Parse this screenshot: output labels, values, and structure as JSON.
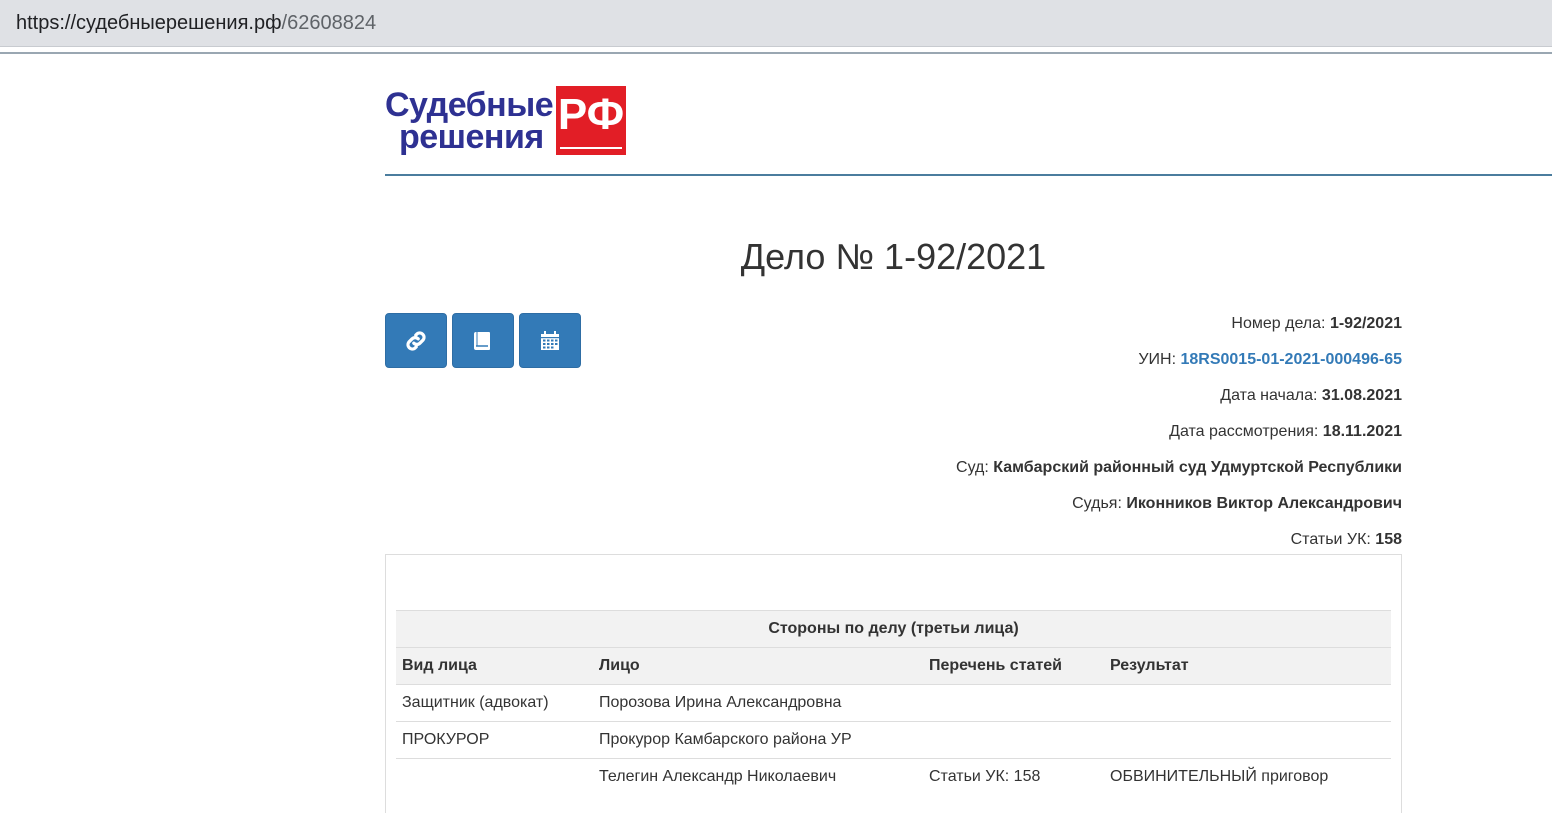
{
  "browser": {
    "url_host": "https://судебныерешения.рф",
    "url_path": "/62608824"
  },
  "logo": {
    "line1": "Судебные",
    "line2": "решения",
    "badge": "РФ",
    "colors": {
      "text": "#2e3192",
      "badge": "#e21e26"
    }
  },
  "page": {
    "title": "Дело № 1-92/2021"
  },
  "toolbar": {
    "buttons": [
      {
        "icon": "link-icon"
      },
      {
        "icon": "book-icon"
      },
      {
        "icon": "calendar-icon"
      }
    ],
    "color": "#337ab7"
  },
  "case_info": {
    "number": {
      "label": "Номер дела:",
      "value": "1-92/2021"
    },
    "uin": {
      "label": "УИН:",
      "value": "18RS0015-01-2021-000496-65"
    },
    "start_date": {
      "label": "Дата начала:",
      "value": "31.08.2021"
    },
    "review_date": {
      "label": "Дата рассмотрения:",
      "value": "18.11.2021"
    },
    "court": {
      "label": "Суд:",
      "value": "Камбарский районный суд Удмуртской Республики"
    },
    "judge": {
      "label": "Судья:",
      "value": "Иконников Виктор Александрович"
    },
    "articles": {
      "label": "Статьи УК:",
      "value": "158"
    }
  },
  "parties": {
    "caption": "Стороны по делу (третьи лица)",
    "columns": [
      "Вид лица",
      "Лицо",
      "Перечень статей",
      "Результат"
    ],
    "rows": [
      [
        "Защитник (адвокат)",
        "Порозова Ирина Александровна",
        "",
        ""
      ],
      [
        "ПРОКУРОР",
        "Прокурор Камбарского района УР",
        "",
        ""
      ],
      [
        "",
        "Телегин Александр Николаевич",
        "Статьи УК: 158",
        "ОБВИНИТЕЛЬНЫЙ приговор"
      ]
    ]
  }
}
